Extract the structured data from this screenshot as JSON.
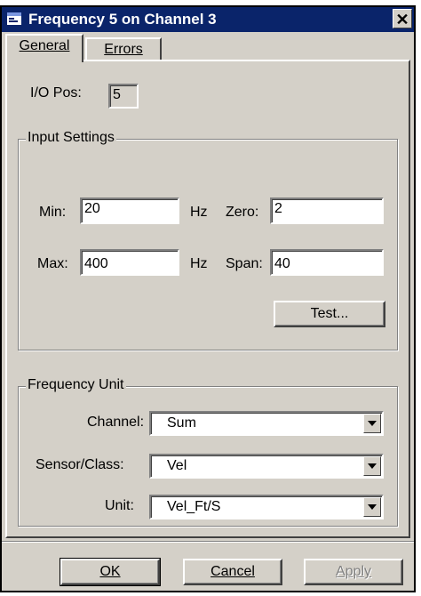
{
  "window": {
    "title": "Frequency 5 on Channel 3",
    "close_glyph": "✕"
  },
  "tabs": [
    {
      "label": "General",
      "active": true
    },
    {
      "label": "Errors",
      "active": false
    }
  ],
  "io_pos": {
    "label": "I/O Pos:",
    "value": "5"
  },
  "input_settings": {
    "title": "Input Settings",
    "min_label": "Min:",
    "min_value": "20",
    "max_label": "Max:",
    "max_value": "400",
    "unit_label": "Hz",
    "zero_label": "Zero:",
    "zero_value": "2",
    "span_label": "Span:",
    "span_value": "40",
    "test_button": "Test..."
  },
  "frequency_unit": {
    "title": "Frequency Unit",
    "channel_label": "Channel:",
    "channel_value": "Sum",
    "sensor_label": "Sensor/Class:",
    "sensor_value": "Vel",
    "unit_label": "Unit:",
    "unit_value": "Vel_Ft/S"
  },
  "buttons": {
    "ok": "OK",
    "cancel": "Cancel",
    "apply": "Apply",
    "apply_disabled": true
  },
  "icons": {
    "app": "app-window-icon",
    "close": "close-icon",
    "dropdown": "chevron-down-icon"
  },
  "colors": {
    "titlebar": "#0a246a",
    "dialog_face": "#d4d0c8"
  }
}
